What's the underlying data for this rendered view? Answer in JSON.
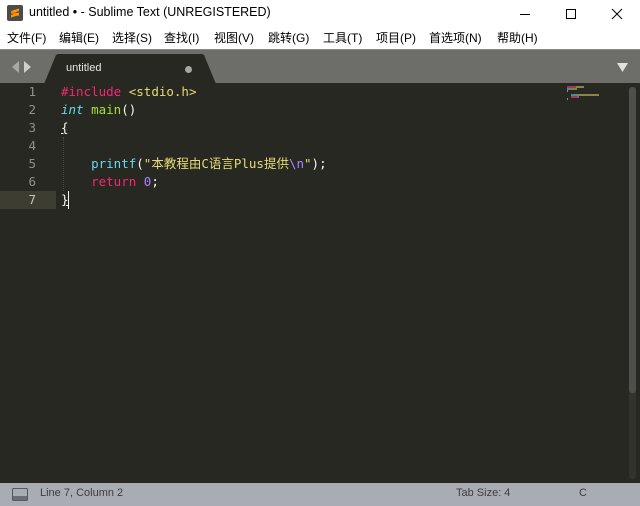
{
  "window": {
    "title": "untitled • - Sublime Text (UNREGISTERED)",
    "controls": [
      "minimize",
      "maximize",
      "close"
    ]
  },
  "menu": {
    "items": [
      {
        "label": "文件(F)"
      },
      {
        "label": "编辑(E)"
      },
      {
        "label": "选择(S)"
      },
      {
        "label": "查找(I)"
      },
      {
        "label": "视图(V)"
      },
      {
        "label": "跳转(G)"
      },
      {
        "label": "工具(T)"
      },
      {
        "label": "项目(P)"
      },
      {
        "label": "首选项(N)"
      },
      {
        "label": "帮助(H)"
      }
    ]
  },
  "tabs": [
    {
      "label": "untitled",
      "dirty": true,
      "active": true
    }
  ],
  "editor": {
    "line_numbers": [
      "1",
      "2",
      "3",
      "4",
      "5",
      "6",
      "7"
    ],
    "current_line": 7,
    "lines": [
      [
        {
          "t": "#include",
          "c": "kw-pre"
        },
        {
          "t": " ",
          "c": ""
        },
        {
          "t": "<stdio.h>",
          "c": "kw-inc"
        }
      ],
      [
        {
          "t": "int",
          "c": "kw-type"
        },
        {
          "t": " ",
          "c": ""
        },
        {
          "t": "main",
          "c": "kw-fn"
        },
        {
          "t": "()",
          "c": ""
        }
      ],
      [
        {
          "t": "{",
          "c": "brace-match"
        }
      ],
      [],
      [
        {
          "t": "    ",
          "c": ""
        },
        {
          "t": "printf",
          "c": "kw-call"
        },
        {
          "t": "(",
          "c": ""
        },
        {
          "t": "\"本教程由C语言Plus提供",
          "c": "kw-str"
        },
        {
          "t": "\\n",
          "c": "kw-esc"
        },
        {
          "t": "\"",
          "c": "kw-str"
        },
        {
          "t": ");",
          "c": ""
        }
      ],
      [
        {
          "t": "    ",
          "c": ""
        },
        {
          "t": "return",
          "c": "kw-ret"
        },
        {
          "t": " ",
          "c": ""
        },
        {
          "t": "0",
          "c": "kw-num"
        },
        {
          "t": ";",
          "c": ""
        }
      ],
      [
        {
          "t": "}",
          "c": "brace-match"
        }
      ]
    ]
  },
  "scrollbar": {
    "visible_fraction": 0.78,
    "position": 0
  },
  "status": {
    "position": "Line 7, Column 2",
    "tab_size": "Tab Size: 4",
    "syntax": "C"
  },
  "colors": {
    "editor_bg": "#272822",
    "tabstrip_bg": "#6d6e69",
    "statusbar_bg": "#a9adb3",
    "keyword": "#f92672",
    "string": "#e6db74",
    "function": "#a6e22e",
    "type": "#66d9ef",
    "number": "#ae81ff"
  }
}
